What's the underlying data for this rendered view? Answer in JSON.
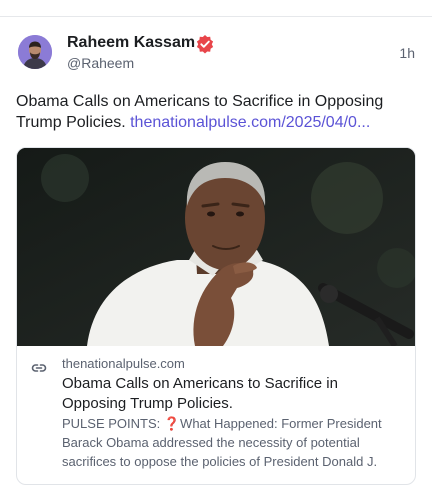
{
  "post": {
    "author_name": "Raheem Kassam",
    "handle": "@Raheem",
    "timestamp": "1h",
    "text": "Obama Calls on Americans to Sacrifice in Opposing Trump Policies.",
    "link_text": "thenationalpulse.com/2025/04/0..."
  },
  "card": {
    "domain": "thenationalpulse.com",
    "title": "Obama Calls on Americans to Sacrifice in Opposing Trump Policies.",
    "description": "PULSE POINTS: ❓What Happened: Former President Barack Obama addressed the necessity of potential sacrifices to oppose the policies of President Donald J."
  },
  "icons": {
    "verified": "verified-badge-icon",
    "link": "link-icon"
  },
  "colors": {
    "link": "#5b53d6",
    "verified": "#e8454a",
    "muted": "#5b6270",
    "border": "#e1e4e8"
  }
}
